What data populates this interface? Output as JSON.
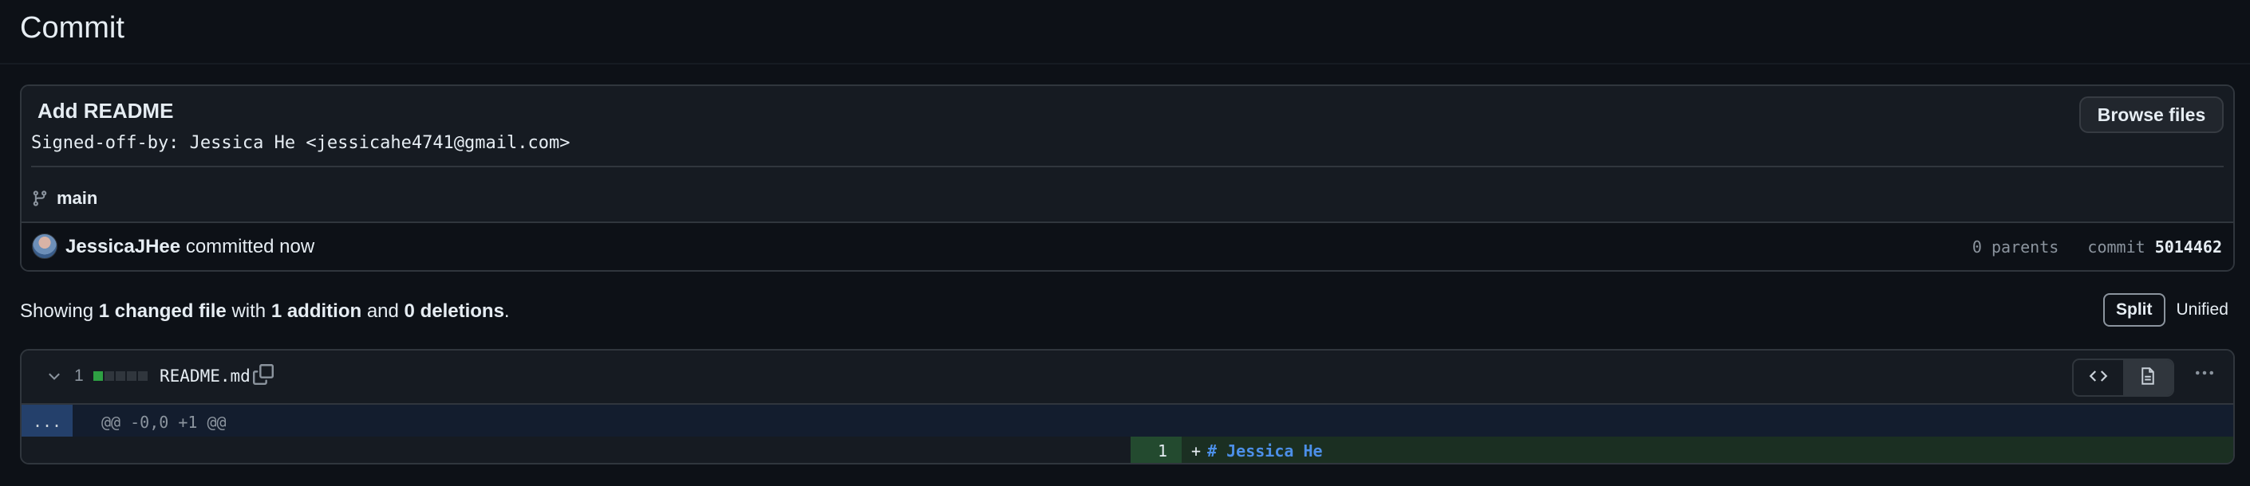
{
  "page": {
    "title": "Commit"
  },
  "commit": {
    "title": "Add README",
    "body": "Signed-off-by: Jessica He <jessicahe4741@gmail.com>",
    "browse_label": "Browse files",
    "branch": "main",
    "author": "JessicaJHee",
    "action": "committed now",
    "parents": "0 parents",
    "commit_label": "commit",
    "sha": "5014462"
  },
  "summary": {
    "prefix": "Showing",
    "files": "1 changed file",
    "with": "with",
    "additions": "1 addition",
    "and": "and",
    "deletions": "0 deletions",
    "suffix": "."
  },
  "view": {
    "split": "Split",
    "unified": "Unified",
    "selected": "Split"
  },
  "file": {
    "count": "1",
    "name": "README.md",
    "diffstat": {
      "additions": 1,
      "deletions": 0,
      "boxes": 5
    },
    "hunk_expand": "...",
    "hunk_header": "@@ -0,0 +1 @@",
    "line_number": "1",
    "line_marker": "+",
    "line_content": "# Jessica He"
  },
  "colors": {
    "addition": "#2ea043",
    "accent_blue": "#4c8fe8",
    "neutral_box": "#30363d"
  },
  "icons": [
    "git-branch-icon",
    "copy-icon",
    "chevron-down-icon",
    "code-icon",
    "file-icon",
    "kebab-icon"
  ]
}
